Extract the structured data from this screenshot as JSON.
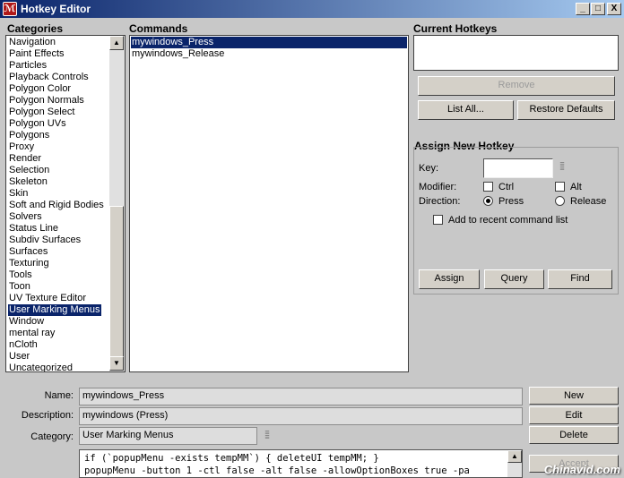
{
  "window": {
    "title": "Hotkey Editor",
    "controls": {
      "minimize": "_",
      "maximize": "□",
      "close": "X"
    }
  },
  "categories": {
    "heading": "Categories",
    "items": [
      "Navigation",
      "Paint Effects",
      "Particles",
      "Playback Controls",
      "Polygon Color",
      "Polygon Normals",
      "Polygon Select",
      "Polygon UVs",
      "Polygons",
      "Proxy",
      "Render",
      "Selection",
      "Skeleton",
      "Skin",
      "Soft and Rigid Bodies",
      "Solvers",
      "Status Line",
      "Subdiv Surfaces",
      "Surfaces",
      "Texturing",
      "Tools",
      "Toon",
      "UV Texture Editor",
      "User Marking Menus",
      "Window",
      "mental ray",
      "nCloth",
      "User",
      "Uncategorized"
    ],
    "selected": "User Marking Menus"
  },
  "commands": {
    "heading": "Commands",
    "items": [
      "mywindows_Press",
      "mywindows_Release"
    ],
    "selected": "mywindows_Press"
  },
  "current_hotkeys": {
    "heading": "Current Hotkeys",
    "remove_label": "Remove",
    "list_all_label": "List All...",
    "restore_defaults_label": "Restore Defaults"
  },
  "assign": {
    "heading": "Assign New Hotkey",
    "key_label": "Key:",
    "key_value": "",
    "modifier_label": "Modifier:",
    "ctrl_label": "Ctrl",
    "alt_label": "Alt",
    "direction_label": "Direction:",
    "press_label": "Press",
    "release_label": "Release",
    "recent_label": "Add to recent command list",
    "assign_label": "Assign",
    "query_label": "Query",
    "find_label": "Find"
  },
  "details": {
    "name_label": "Name:",
    "name_value": "mywindows_Press",
    "description_label": "Description:",
    "description_value": "mywindows (Press)",
    "category_label": "Category:",
    "category_value": "User Marking Menus",
    "code_lines": [
      "if (`popupMenu -exists tempMM`) { deleteUI tempMM; }",
      "popupMenu -button 1 -ctl false -alt false -allowOptionBoxes true -pa"
    ],
    "new_label": "New",
    "edit_label": "Edit",
    "delete_label": "Delete",
    "accept_label": "Accept"
  },
  "watermark": "Chinavid.com"
}
